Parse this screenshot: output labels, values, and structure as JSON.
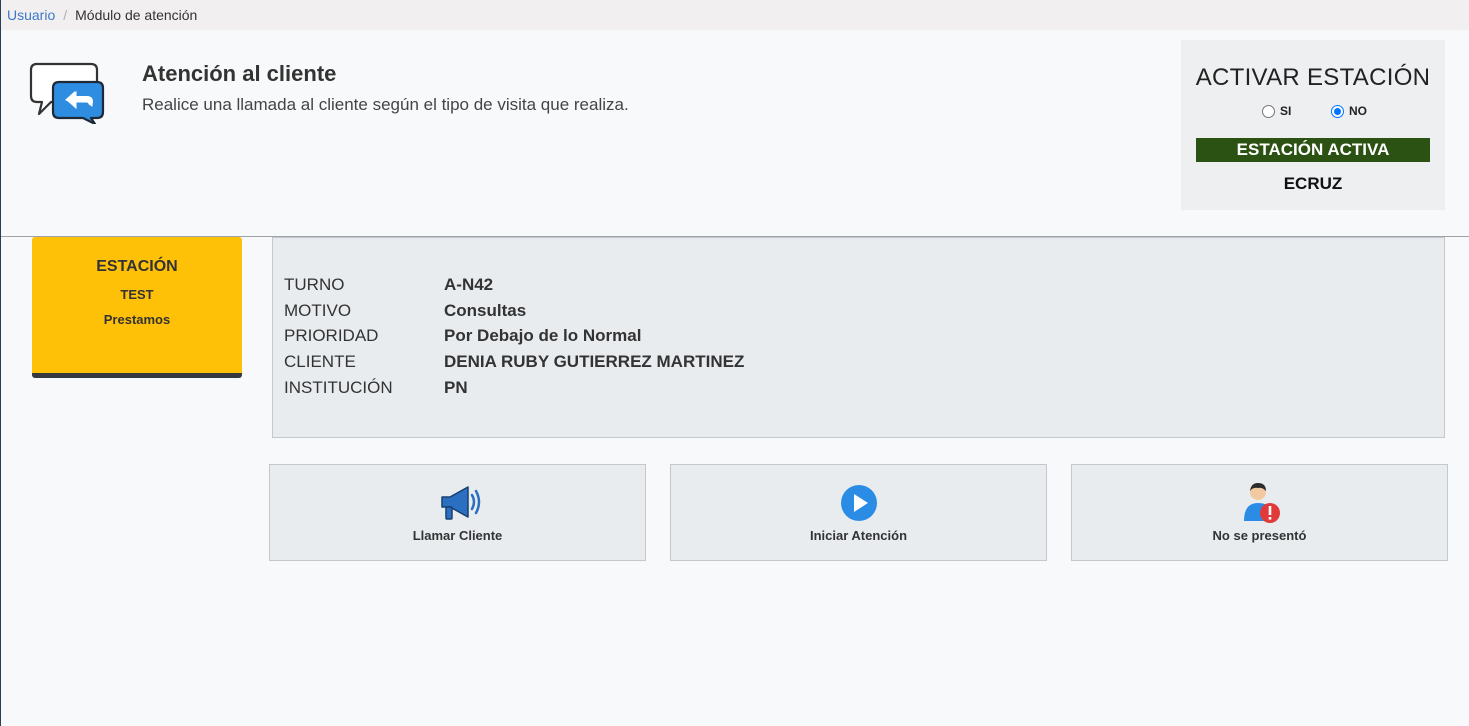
{
  "breadcrumb": {
    "items": [
      "Usuario",
      "Módulo de atención"
    ]
  },
  "header": {
    "icon": "chat-reply-icon",
    "title": "Atención al cliente",
    "subtitle": "Realice una llamada al cliente según el tipo de visita que realiza."
  },
  "activar": {
    "title": "ACTIVAR ESTACIÓN",
    "options": [
      {
        "label": "SI",
        "checked": false
      },
      {
        "label": "NO",
        "checked": true
      }
    ],
    "status": "ESTACIÓN ACTIVA",
    "status_color": "#2c5213",
    "user": "ECRUZ"
  },
  "estacion": {
    "title": "ESTACIÓN",
    "name": "TEST",
    "service": "Prestamos",
    "color": "#ffc107"
  },
  "turno": {
    "rows": [
      {
        "label": "TURNO",
        "value": "A-N42"
      },
      {
        "label": "MOTIVO",
        "value": "Consultas"
      },
      {
        "label": "PRIORIDAD",
        "value": "Por Debajo de lo Normal"
      },
      {
        "label": "CLIENTE",
        "value": "DENIA RUBY GUTIERREZ MARTINEZ"
      },
      {
        "label": "INSTITUCIÓN",
        "value": "PN"
      }
    ]
  },
  "actions": [
    {
      "label": "Llamar Cliente",
      "icon": "megaphone-icon"
    },
    {
      "label": "Iniciar Atención",
      "icon": "play-circle-icon"
    },
    {
      "label": "No se presentó",
      "icon": "user-alert-icon"
    }
  ]
}
